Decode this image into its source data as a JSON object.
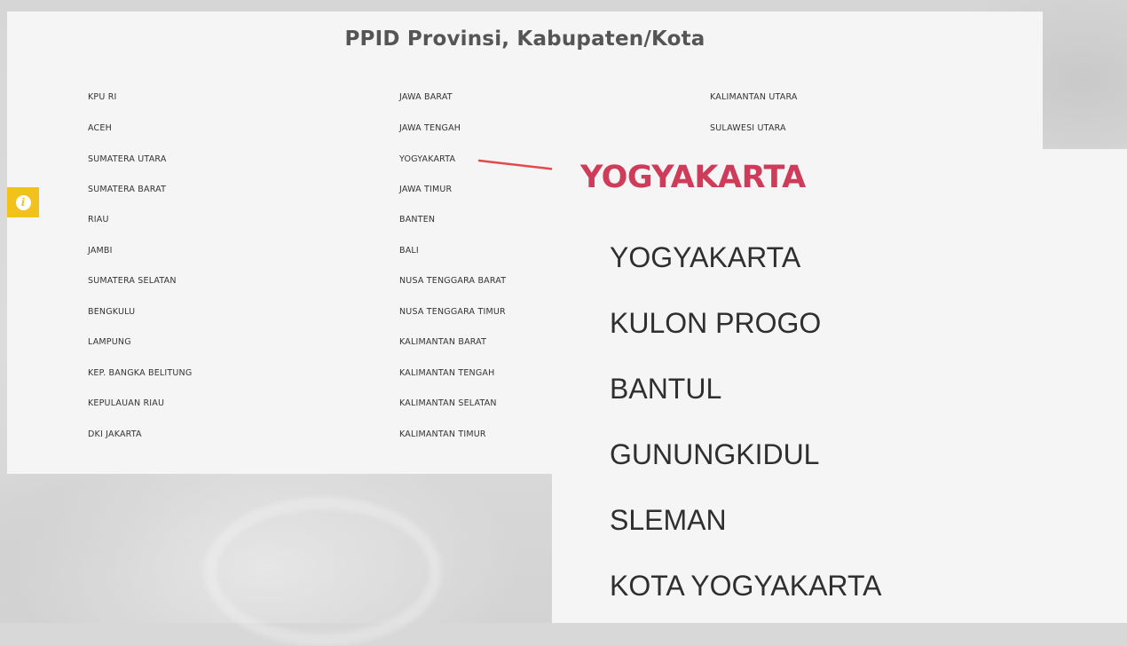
{
  "page": {
    "title": "PPID Provinsi, Kabupaten/Kota"
  },
  "columns": [
    [
      "KPU RI",
      "ACEH",
      "SUMATERA UTARA",
      "SUMATERA BARAT",
      "RIAU",
      "JAMBI",
      "SUMATERA SELATAN",
      "BENGKULU",
      "LAMPUNG",
      "KEP. BANGKA BELITUNG",
      "KEPULAUAN RIAU",
      "DKI JAKARTA"
    ],
    [
      "JAWA BARAT",
      "JAWA TENGAH",
      "YOGYAKARTA",
      "JAWA TIMUR",
      "BANTEN",
      "BALI",
      "NUSA TENGGARA BARAT",
      "NUSA TENGGARA TIMUR",
      "KALIMANTAN BARAT",
      "KALIMANTAN TENGAH",
      "KALIMANTAN SELATAN",
      "KALIMANTAN TIMUR"
    ],
    [
      "KALIMANTAN UTARA",
      "SULAWESI UTARA"
    ]
  ],
  "zoom": {
    "title": "YOGYAKARTA",
    "items": [
      "YOGYAKARTA",
      "KULON PROGO",
      "BANTUL",
      "GUNUNGKIDUL",
      "SLEMAN",
      "KOTA YOGYAKARTA"
    ]
  },
  "colors": {
    "accent": "#cf3c5a",
    "arrow": "#e5484d",
    "info_tab": "#f2c21b"
  },
  "icons": {
    "info": "info-icon",
    "arrow": "arrow-right-icon"
  }
}
